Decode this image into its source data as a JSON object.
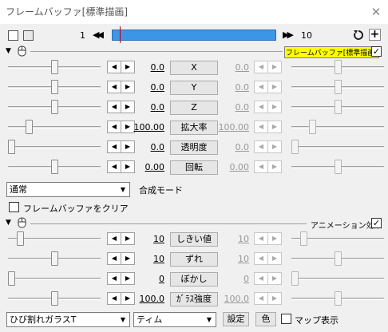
{
  "window": {
    "title": "フレームバッファ[標準描画]",
    "close_glyph": "✕"
  },
  "toolbar": {
    "frame_start": "1",
    "frame_end": "10",
    "nav_prev_glyph": "◀◀",
    "nav_next_glyph": "▶▶",
    "add_glyph": "+",
    "current_frame": 1,
    "total_frames": 10
  },
  "section1": {
    "label": "フレームバッファ[標準描画]",
    "checked": true,
    "check_glyph": "✓",
    "params": [
      {
        "name": "X",
        "value": "0.0",
        "end_value": "0.0",
        "slider_left": 0.5,
        "slider_right": 0.5
      },
      {
        "name": "Y",
        "value": "0.0",
        "end_value": "0.0",
        "slider_left": 0.5,
        "slider_right": 0.5
      },
      {
        "name": "Z",
        "value": "0.0",
        "end_value": "0.0",
        "slider_left": 0.5,
        "slider_right": 0.5
      },
      {
        "name": "拡大率",
        "value": "100.00",
        "end_value": "100.00",
        "slider_left": 0.2,
        "slider_right": 0.2
      },
      {
        "name": "透明度",
        "value": "0.0",
        "end_value": "0.0",
        "slider_left": 0.0,
        "slider_right": 0.0
      },
      {
        "name": "回転",
        "value": "0.00",
        "end_value": "0.00",
        "slider_left": 0.5,
        "slider_right": 0.5
      }
    ]
  },
  "blend": {
    "value": "通常",
    "label": "合成モード",
    "dd_glyph": "▼"
  },
  "clear_checkbox": {
    "label": "フレームバッファをクリア",
    "checked": false
  },
  "section2": {
    "label": "アニメーション効果",
    "checked": true,
    "check_glyph": "✓",
    "params": [
      {
        "name": "しきい値",
        "value": "10",
        "end_value": "10",
        "slider_left": 0.1,
        "slider_right": 0.1
      },
      {
        "name": "ずれ",
        "value": "10",
        "end_value": "10",
        "slider_left": 0.5,
        "slider_right": 0.5
      },
      {
        "name": "ぼかし",
        "value": "0",
        "end_value": "0",
        "slider_left": 0.0,
        "slider_right": 0.0
      },
      {
        "name": "ｶﾞﾗｽ強度",
        "value": "100.0",
        "end_value": "100.0",
        "slider_left": 0.5,
        "slider_right": 0.5
      }
    ]
  },
  "bottom": {
    "effect_combo": "ひび割れガラスT",
    "preset_combo": "ティム",
    "settings_label": "設定",
    "color_label": "色",
    "map_label": "マップ表示",
    "map_checked": false
  },
  "arrows": {
    "left": "◀",
    "right": "▶"
  }
}
